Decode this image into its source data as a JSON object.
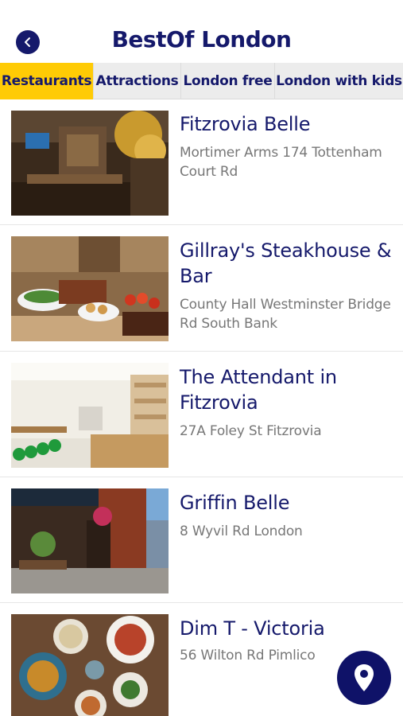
{
  "header": {
    "title": "BestOf London",
    "back_icon": "chevron-left-icon"
  },
  "tabs": [
    {
      "label": "Restaurants",
      "active": true
    },
    {
      "label": "Attractions",
      "active": false
    },
    {
      "label": "London free",
      "active": false
    },
    {
      "label": "London with kids",
      "active": false
    }
  ],
  "restaurants": [
    {
      "name": "Fitzrovia Belle",
      "address": "Mortimer Arms 174 Tottenham Court Rd",
      "image": "pub interior photo"
    },
    {
      "name": "Gillray's Steakhouse & Bar",
      "address": "County Hall Westminster Bridge Rd South Bank",
      "image": "steak platter photo"
    },
    {
      "name": "The Attendant in Fitzrovia",
      "address": "27A Foley St Fitzrovia",
      "image": "cafe interior photo"
    },
    {
      "name": "Griffin Belle",
      "address": "8 Wyvil Rd London",
      "image": "pub exterior photo"
    },
    {
      "name": "Dim T - Victoria",
      "address": "56 Wilton Rd Pimlico",
      "image": "dim sum dishes photo"
    }
  ],
  "fab": {
    "icon": "map-pin-icon"
  },
  "colors": {
    "brand": "#15196b",
    "active_tab": "#ffcb05",
    "address": "#777777"
  }
}
